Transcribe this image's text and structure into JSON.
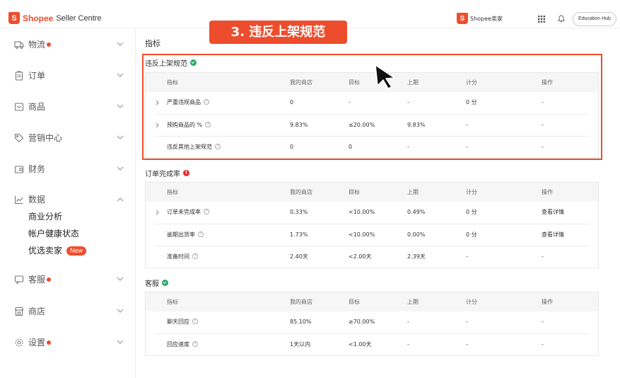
{
  "header": {
    "brand_logo": "S",
    "brand_name": "Shopee",
    "brand_sub": "Seller Centre",
    "shop_logo": "S",
    "shop_label": "Shopee卖家",
    "education_hub": "Education Hub"
  },
  "sidebar": {
    "items": [
      {
        "label": "物流",
        "icon": "truck-icon",
        "dot": true
      },
      {
        "label": "订单",
        "icon": "clipboard-icon",
        "dot": false
      },
      {
        "label": "商品",
        "icon": "box-icon",
        "dot": false
      },
      {
        "label": "营销中心",
        "icon": "tag-icon",
        "dot": false
      },
      {
        "label": "财务",
        "icon": "wallet-icon",
        "dot": false
      },
      {
        "label": "数据",
        "icon": "chart-icon",
        "dot": false
      },
      {
        "label": "客服",
        "icon": "chat-icon",
        "dot": true
      },
      {
        "label": "商店",
        "icon": "store-icon",
        "dot": false
      },
      {
        "label": "设置",
        "icon": "gear-icon",
        "dot": true
      }
    ],
    "data_sub": [
      "商业分析",
      "帐户健康状态",
      "优选卖家"
    ],
    "new_badge": "New"
  },
  "main": {
    "title": "指标",
    "banner": "3. 违反上架规范",
    "headers": {
      "name": "指标",
      "mine": "我的商店",
      "target": "目标",
      "prev": "上期",
      "score": "计分",
      "action": "操作"
    },
    "sections": [
      {
        "title": "违反上架规范",
        "status": "ok",
        "rows": [
          {
            "name": "严重违规商品",
            "expand": true,
            "mine": "0",
            "target": "-",
            "prev": "-",
            "score": "0 分",
            "action": "-"
          },
          {
            "name": "预购商品的 %",
            "expand": true,
            "mine": "9.83%",
            "target": "≤20.00%",
            "prev": "9.83%",
            "score": "-",
            "action": "-"
          },
          {
            "name": "违反其他上架规范",
            "expand": false,
            "mine": "0",
            "target": "0",
            "prev": "-",
            "score": "-",
            "action": "-"
          }
        ]
      },
      {
        "title": "订单完成率",
        "status": "warn",
        "rows": [
          {
            "name": "订单未完成率",
            "expand": true,
            "mine": "0.33%",
            "target": "<10.00%",
            "prev": "0.49%",
            "score": "0 分",
            "action": "查看详情"
          },
          {
            "name": "逾期出货率",
            "expand": false,
            "mine": "1.73%",
            "target": "<10.00%",
            "prev": "0.00%",
            "score": "0 分",
            "action": "查看详情"
          },
          {
            "name": "准备时间",
            "expand": false,
            "mine": "2.40天",
            "target": "<2.00天",
            "prev": "2.39天",
            "score": "-",
            "action": "-"
          }
        ]
      },
      {
        "title": "客服",
        "status": "ok",
        "rows": [
          {
            "name": "聊天回应",
            "expand": false,
            "mine": "85.10%",
            "target": "≥70.00%",
            "prev": "-",
            "score": "-",
            "action": "-"
          },
          {
            "name": "回应速度",
            "expand": false,
            "mine": "1天以内",
            "target": "<1.00天",
            "prev": "-",
            "score": "-",
            "action": "-"
          }
        ]
      }
    ]
  },
  "colors": {
    "brand": "#ee4d2d",
    "ok": "#26aa67",
    "link": "#2673dd"
  }
}
